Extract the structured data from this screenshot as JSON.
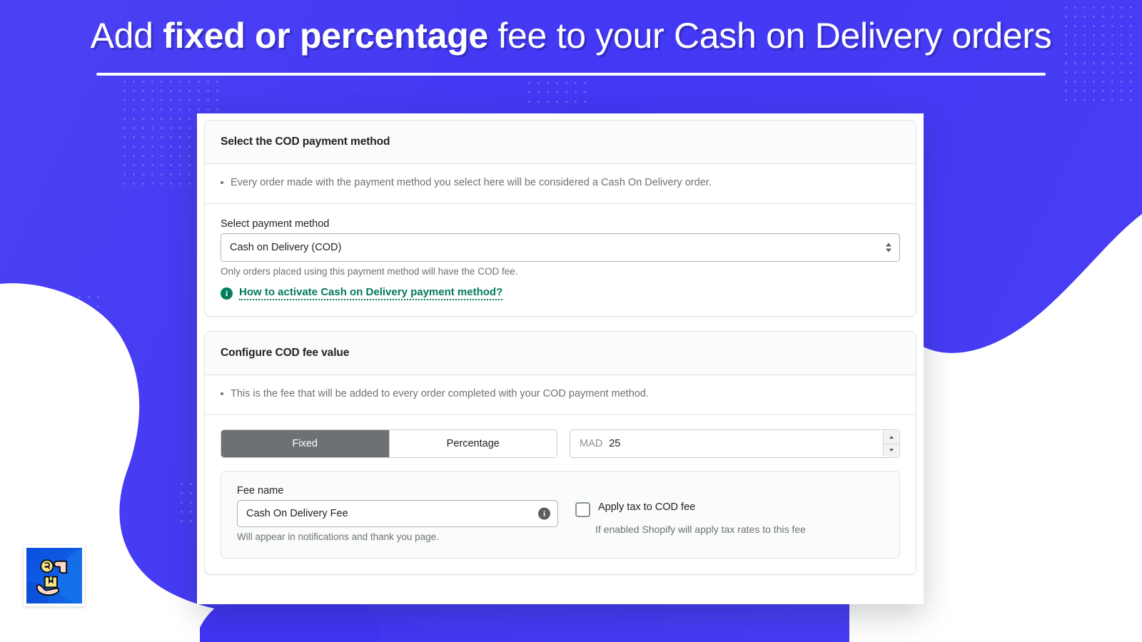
{
  "hero": {
    "title_pre": "Add ",
    "title_bold": "fixed or percentage",
    "title_post": " fee to your Cash on Delivery orders",
    "accent_blue": "#4a3ff5",
    "rule_color": "#ffffff"
  },
  "app_icon": {
    "name": "cash-on-delivery-app-icon",
    "bg_from": "#0b4fe0",
    "bg_to": "#1677e8",
    "coin_color": "#f7e58a",
    "hand_color": "#fbd9cf",
    "box_color": "#f7e58a"
  },
  "card_payment": {
    "title": "Select the COD payment method",
    "note": "Every order made with the payment method you select here will be considered a Cash On Delivery order.",
    "select_label": "Select payment method",
    "select_value": "Cash on Delivery (COD)",
    "select_options": [
      "Cash on Delivery (COD)"
    ],
    "help_text": "Only orders placed using this payment method will have the COD fee.",
    "link_text": "How to activate Cash on Delivery payment method?",
    "link_icon": "info-icon",
    "link_color": "#007a5c"
  },
  "card_fee": {
    "title": "Configure COD fee value",
    "note": "This is the fee that will be added to every order completed with your COD payment method.",
    "segmented": {
      "options": [
        "Fixed",
        "Percentage"
      ],
      "selected": "Fixed",
      "active_bg": "#6d7175"
    },
    "amount": {
      "prefix": "MAD",
      "value": "25",
      "stepper_up_icon": "caret-up-icon",
      "stepper_down_icon": "caret-down-icon"
    },
    "fee_name": {
      "label": "Fee name",
      "value": "Cash On Delivery Fee",
      "info_icon": "info-icon",
      "help_text": "Will appear in notifications and thank you page."
    },
    "tax": {
      "checked": false,
      "label": "Apply tax to COD fee",
      "help_text": "If enabled Shopify will apply tax rates to this fee"
    }
  }
}
